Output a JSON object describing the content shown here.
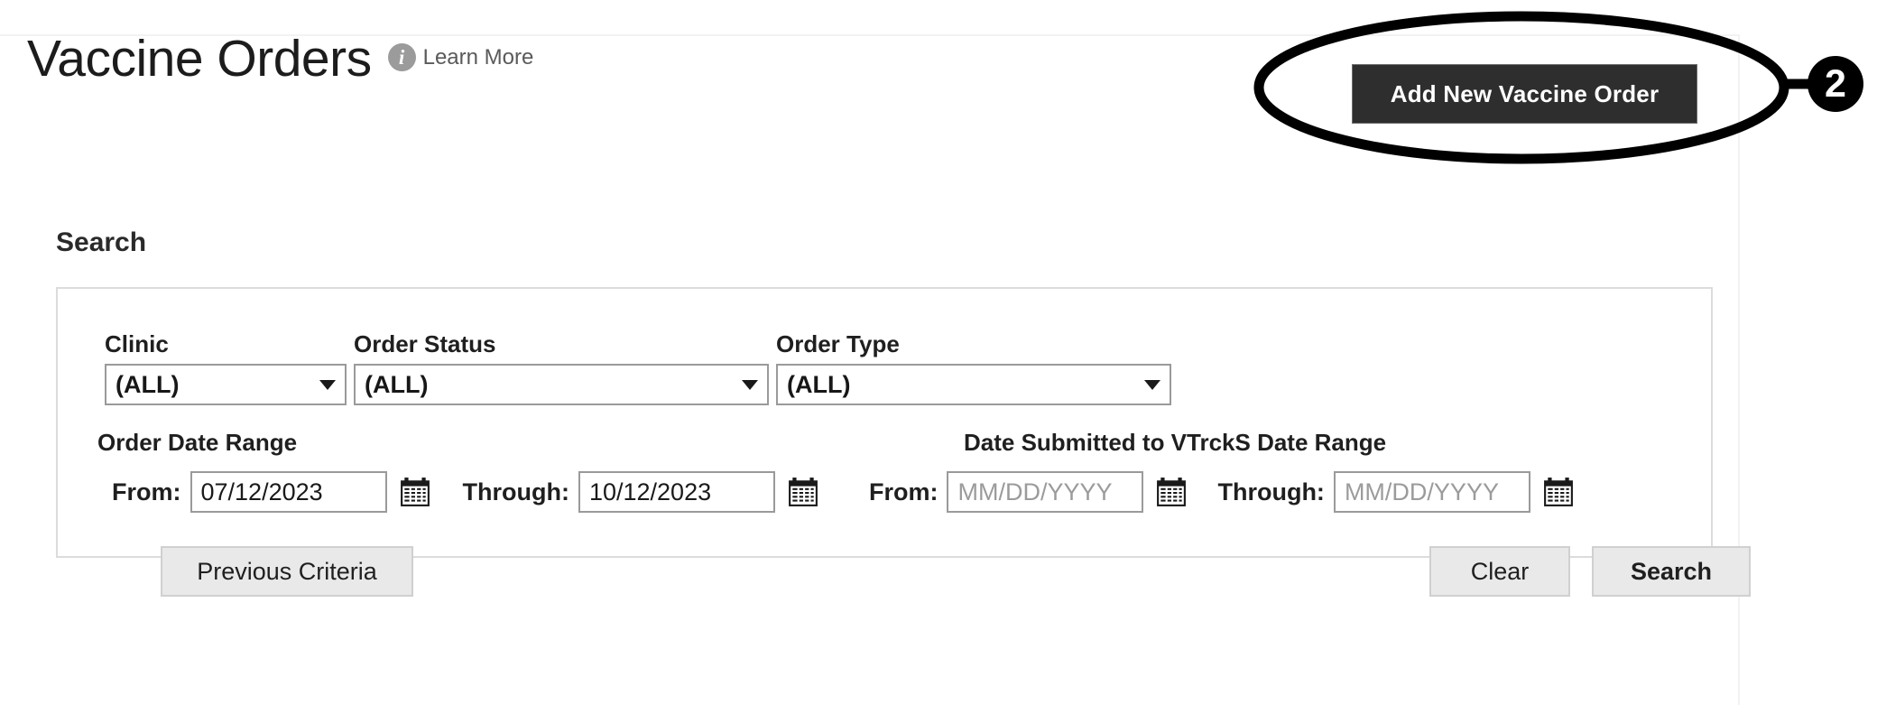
{
  "page": {
    "title": "Vaccine Orders",
    "learn_more": "Learn More",
    "info_glyph": "i"
  },
  "header": {
    "add_new_button": "Add New Vaccine Order"
  },
  "search": {
    "heading": "Search",
    "filters": [
      {
        "label": "Clinic",
        "value": "(ALL)"
      },
      {
        "label": "Order Status",
        "value": "(ALL)"
      },
      {
        "label": "Order Type",
        "value": "(ALL)"
      }
    ],
    "order_date_range": {
      "label": "Order Date Range",
      "from_caption": "From:",
      "from_value": "07/12/2023",
      "through_caption": "Through:",
      "through_value": "10/12/2023"
    },
    "vtrcks_date_range": {
      "label": "Date Submitted to VTrckS Date Range",
      "from_caption": "From:",
      "from_placeholder": "MM/DD/YYYY",
      "through_caption": "Through:",
      "through_placeholder": "MM/DD/YYYY"
    },
    "buttons": {
      "previous_criteria": "Previous Criteria",
      "clear": "Clear",
      "search": "Search"
    }
  },
  "annotation": {
    "callout_number": "2"
  },
  "colors": {
    "add_button_bg": "#2e2e2e",
    "add_button_text": "#ffffff",
    "info_icon_bg": "#9b9b9b",
    "annotation": "#000000",
    "field_border": "#9a9a9a",
    "panel_border": "#dcdcdc",
    "button_bg": "#e9e9e9"
  }
}
